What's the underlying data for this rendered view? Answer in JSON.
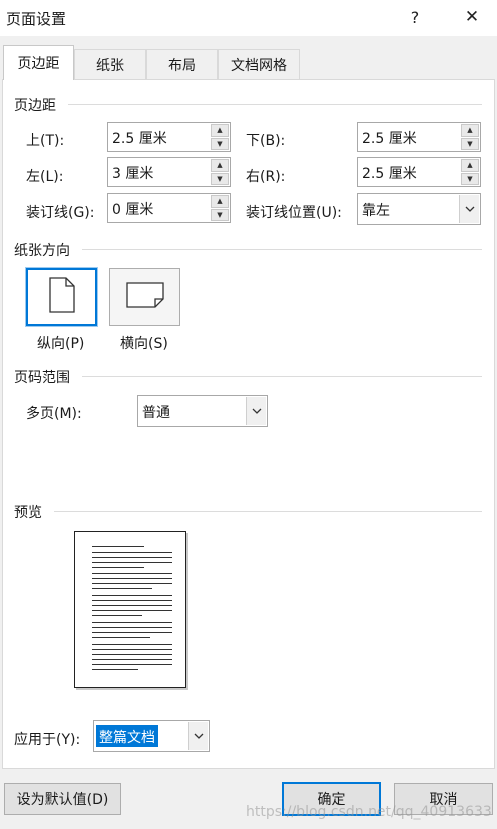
{
  "window": {
    "title": "页面设置",
    "help_glyph": "?",
    "close_glyph": "✕"
  },
  "tabs": [
    {
      "label": "页边距"
    },
    {
      "label": "纸张"
    },
    {
      "label": "布局"
    },
    {
      "label": "文档网格"
    }
  ],
  "margins": {
    "section_title": "页边距",
    "top": {
      "label": "上(T):",
      "value": "2.5 厘米"
    },
    "bottom": {
      "label": "下(B):",
      "value": "2.5 厘米"
    },
    "left": {
      "label": "左(L):",
      "value": "3 厘米"
    },
    "right": {
      "label": "右(R):",
      "value": "2.5 厘米"
    },
    "gutter": {
      "label": "装订线(G):",
      "value": "0 厘米"
    },
    "gutter_position": {
      "label": "装订线位置(U):",
      "value": "靠左"
    }
  },
  "orientation": {
    "section_title": "纸张方向",
    "portrait_label": "纵向(P)",
    "landscape_label": "横向(S)",
    "selected": "portrait"
  },
  "pages": {
    "section_title": "页码范围",
    "multiple_label": "多页(M):",
    "multiple_value": "普通"
  },
  "preview": {
    "section_title": "预览"
  },
  "apply": {
    "label": "应用于(Y):",
    "value": "整篇文档"
  },
  "buttons": {
    "set_default": "设为默认值(D)",
    "ok": "确定",
    "cancel": "取消"
  },
  "watermark": "https://blog.csdn.net/qq_40913633",
  "colors": {
    "accent": "#0078d7",
    "selection_bg": "#0078d7",
    "dialog_bg": "#f0f0f0"
  }
}
